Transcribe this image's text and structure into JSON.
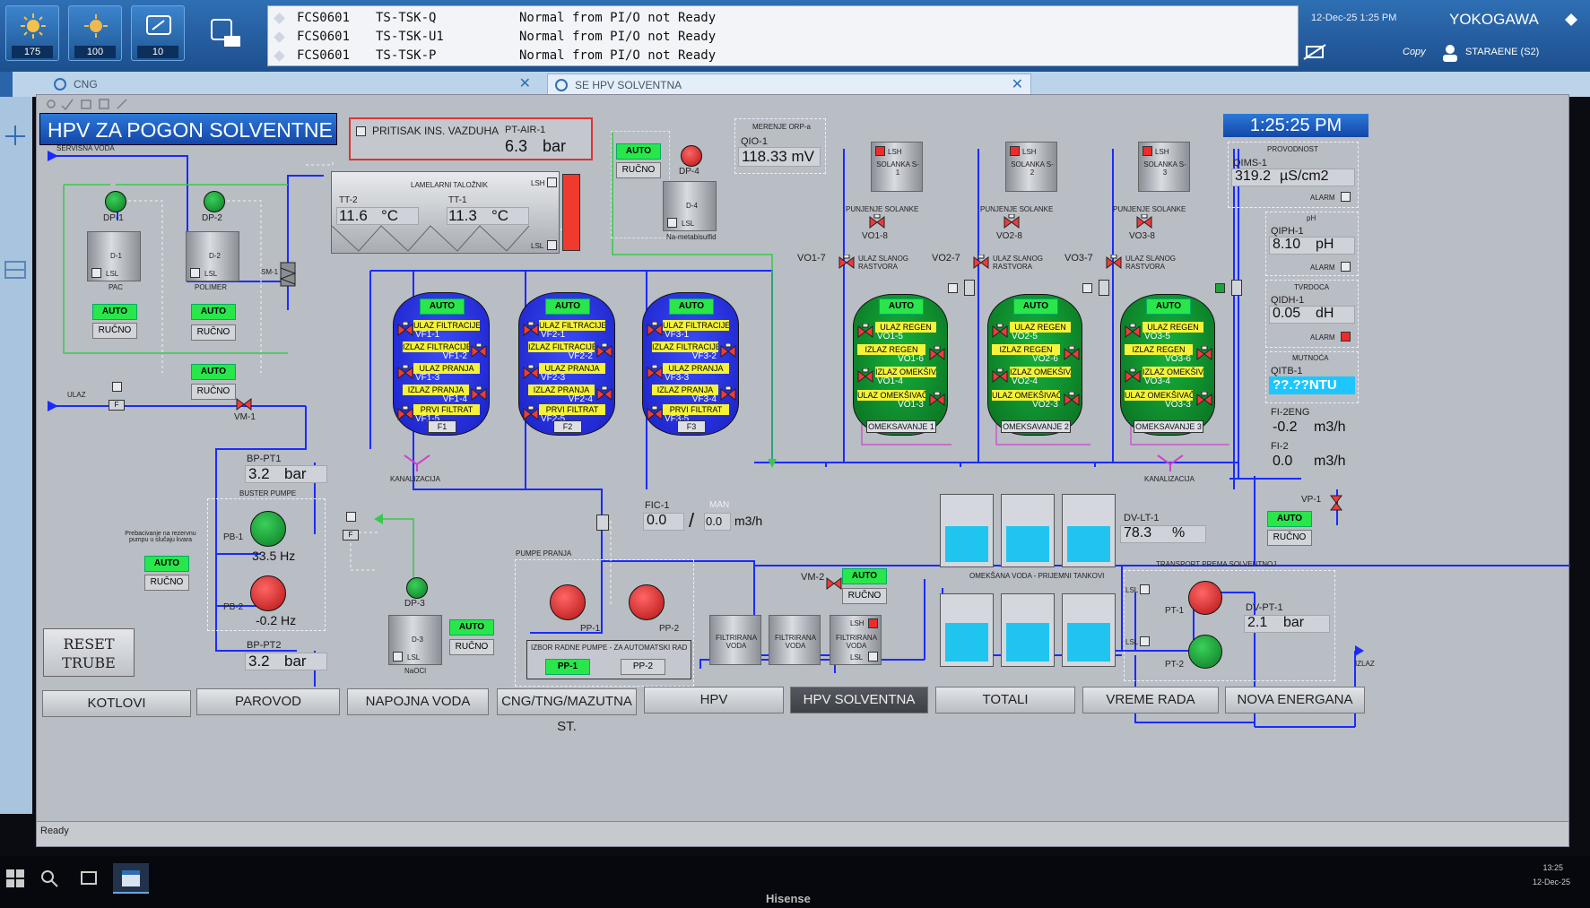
{
  "top": {
    "counters": [
      "175",
      "100",
      "10"
    ],
    "alarms": [
      {
        "station": "FCS0601",
        "tag": "TS-TSK-Q",
        "msg": "Normal from PI/O not Ready"
      },
      {
        "station": "FCS0601",
        "tag": "TS-TSK-U1",
        "msg": "Normal from PI/O not Ready"
      },
      {
        "station": "FCS0601",
        "tag": "TS-TSK-P",
        "msg": "Normal from PI/O not Ready"
      }
    ],
    "datetime": "12-Dec-25 1:25 PM",
    "brand": "YOKOGAWA",
    "copy": "Copy",
    "user": "STARAENE (S2)"
  },
  "windows": {
    "tab1": "CNG",
    "tab2": "SE HPV SOLVENTNA"
  },
  "page": {
    "title": "HPV ZA POGON SOLVENTNE",
    "clock": "1:25:25 PM",
    "servisna": "SERVISNA VODA",
    "ulaz": "ULAZ",
    "izlaz": "IZLAZ",
    "kanalizacija": "KANALIZACIJA",
    "auto": "AUTO",
    "rucno": "RUČNO",
    "lsh": "LSH",
    "lsl": "LSL",
    "alarm": "ALARM",
    "reset": "RESET TRUBE",
    "status": "Ready"
  },
  "air": {
    "label": "PRITISAK INS. VAZDUHA",
    "tag": "PT-AIR-1",
    "value": "6.3",
    "unit": "bar"
  },
  "settler": {
    "name": "LAMELARNI TALOŽNIK",
    "tt2": "TT-2",
    "tt2v": "11.6",
    "tt1": "TT-1",
    "tt1v": "11.3",
    "unit": "°C"
  },
  "orp": {
    "title": "MERENJE ORP-a",
    "tag": "QIO-1",
    "value": "118.33 mV"
  },
  "dosing": {
    "dp1": "DP-1",
    "d1": "D-1",
    "pac": "PAC",
    "dp2": "DP-2",
    "d2": "D-2",
    "polimer": "POLIMER",
    "dp4": "DP-4",
    "d4": "D-4",
    "nameta": "Na-metabisulfid",
    "dp3": "DP-3",
    "d3": "D-3",
    "naocl": "NaOCl",
    "sm1": "SM-1",
    "vm1": "VM-1",
    "vm2": "VM-2",
    "vp1": "VP-1"
  },
  "filters": [
    {
      "name": "F1",
      "labels": [
        "ULAZ FILTRACIJE",
        "IZLAZ FILTRACIJE",
        "ULAZ PRANJA",
        "IZLAZ PRANJA",
        "PRVI FILTRAT"
      ],
      "valves": [
        "VF1-1",
        "VF1-2",
        "VF1-3",
        "VF1-4",
        "VF1-5"
      ]
    },
    {
      "name": "F2",
      "labels": [
        "ULAZ FILTRACIJE",
        "IZLAZ FILTRACIJE",
        "ULAZ PRANJA",
        "IZLAZ PRANJA",
        "PRVI FILTRAT"
      ],
      "valves": [
        "VF2-1",
        "VF2-2",
        "VF2-3",
        "VF2-4",
        "VF2-5"
      ]
    },
    {
      "name": "F3",
      "labels": [
        "ULAZ FILTRACIJE",
        "IZLAZ FILTRACIJE",
        "ULAZ PRANJA",
        "IZLAZ PRANJA",
        "PRVI FILTRAT"
      ],
      "valves": [
        "VF3-1",
        "VF3-2",
        "VF3-3",
        "VF3-4",
        "VF3-5"
      ]
    }
  ],
  "softeners": [
    {
      "name": "OMEKSAVANJE 1",
      "labels": [
        "ULAZ REGEN",
        "IZLAZ REGEN",
        "IZLAZ OMEKŠIVAČA",
        "ULAZ OMEKŠIVAČA"
      ],
      "valves": [
        "VO1-5",
        "VO1-6",
        "VO1-4",
        "VO1-3"
      ],
      "solanka": "SOLANKA S-1",
      "punjenje": "PUNJENJE SOLANKE",
      "v8": "VO1-8",
      "v7": "VO1-7",
      "slang": "ULAZ SLANOG RASTVORA"
    },
    {
      "name": "OMEKSAVANJE 2",
      "labels": [
        "ULAZ REGEN",
        "IZLAZ REGEN",
        "IZLAZ OMEKŠIVAČA",
        "ULAZ OMEKŠIVAČA"
      ],
      "valves": [
        "VO2-5",
        "VO2-6",
        "VO2-4",
        "VO2-3"
      ],
      "solanka": "SOLANKA S-2",
      "punjenje": "PUNJENJE SOLANKE",
      "v8": "VO2-8",
      "v7": "VO2-7",
      "slang": "ULAZ SLANOG RASTVORA"
    },
    {
      "name": "OMEKSAVANJE 3",
      "labels": [
        "ULAZ REGEN",
        "IZLAZ REGEN",
        "IZLAZ OMEKŠIVAČA",
        "ULAZ OMEKŠIVAČA"
      ],
      "valves": [
        "VO3-5",
        "VO3-6",
        "VO3-4",
        "VO3-3"
      ],
      "solanka": "SOLANKA S-3",
      "punjenje": "PUNJENJE SOLANKE",
      "v8": "VO3-8",
      "v7": "VO3-7",
      "slang": "ULAZ SLANOG RASTVORA"
    }
  ],
  "analysis": {
    "provodnost": "PROVODNOST",
    "qims": "QIMS-1",
    "qimsv": "319.2",
    "qimsu": "µS/cm2",
    "ph": "pH",
    "qiph": "QIPH-1",
    "qiphv": "8.10",
    "qiphu": "pH",
    "tvrdoca": "TVRDOCA",
    "qidh": "QIDH-1",
    "qidhv": "0.05",
    "qidhu": "dH",
    "mutnoca": "MUTNOĆA",
    "qitb": "QITB-1",
    "qitbv": "??.??NTU",
    "fi2eng": "FI-2ENG",
    "fi2engv": "-0.2",
    "fi2": "FI-2",
    "fi2v": "0.0",
    "flowu": "m3/h"
  },
  "booster": {
    "title": "BUSTER PUMPE",
    "bp1": "BP-PT1",
    "bp1v": "3.2",
    "bp2": "BP-PT2",
    "bp2v": "3.2",
    "unit": "bar",
    "pb1": "PB-1",
    "pb1v": "33.5 Hz",
    "pb2": "PB-2",
    "pb2v": "-0.2 Hz",
    "note": "Prebacivanje na rezervnu pumpu u slučaju kvara"
  },
  "fic": {
    "tag": "FIC-1",
    "man": "MAN",
    "pv": "0.0",
    "sv": "0.0",
    "unit": "m3/h"
  },
  "wash": {
    "title": "PUMPE PRANJA",
    "pp1": "PP-1",
    "pp2": "PP-2",
    "select": "IZBOR RADNE PUMPE - ZA AUTOMATSKI RAD"
  },
  "filtered": [
    "FILTRIRANA VODA",
    "FILTRIRANA VODA",
    "FILTRIRANA VODA"
  ],
  "tanks": {
    "title": "OMEKŠANA VODA - PRIJEMNI TANKOVI",
    "lt": "DV-LT-1",
    "ltv": "78.3",
    "ltu": "%",
    "level_pct": [
      55,
      55,
      55,
      60,
      60,
      60
    ]
  },
  "transport": {
    "title": "TRANSPORT PREMA SOLVENTNOJ",
    "pt1": "PT-1",
    "pt2": "PT-2",
    "dv": "DV-PT-1",
    "dvv": "2.1",
    "unit": "bar"
  },
  "nav": [
    "KOTLOVI",
    "PAROVOD",
    "NAPOJNA VODA",
    "CNG/TNG/MAZUTNA ST.",
    "HPV",
    "HPV SOLVENTNA",
    "TOTALI",
    "VREME RADA",
    "NOVA ENERGANA"
  ],
  "taskbar": {
    "time": "13:25",
    "date": "12-Dec-25",
    "brand": "Hisense"
  },
  "colors": {
    "blue_vessel": "#2a34e6",
    "green_vessel": "#0f9a31",
    "auto": "#29e64b",
    "pipe": "#1a2bff",
    "title": "#1f5fc4"
  }
}
